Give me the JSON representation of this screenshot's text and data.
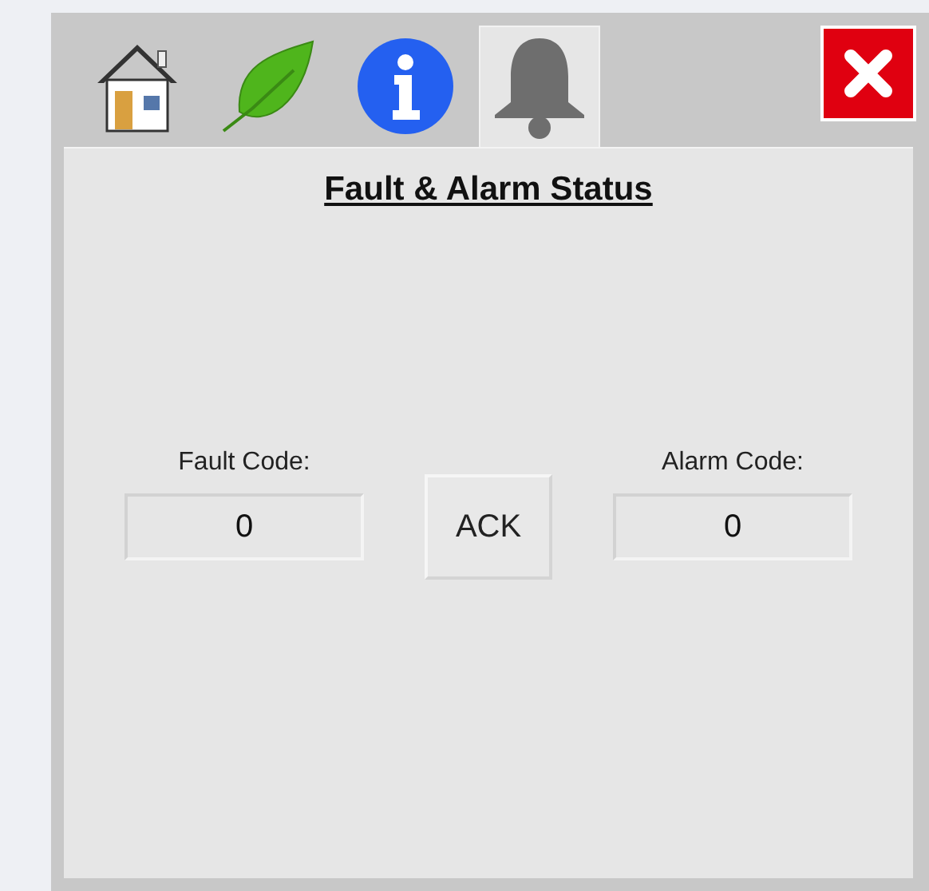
{
  "tabs": [
    {
      "kind": "home",
      "selected": false
    },
    {
      "kind": "leaf",
      "selected": false
    },
    {
      "kind": "info",
      "selected": false
    },
    {
      "kind": "bell",
      "selected": true
    }
  ],
  "title": "Fault & Alarm Status",
  "fault": {
    "label": "Fault Code:",
    "value": "0"
  },
  "ack_button": "ACK",
  "alarm": {
    "label": "Alarm Code:",
    "value": "0"
  }
}
